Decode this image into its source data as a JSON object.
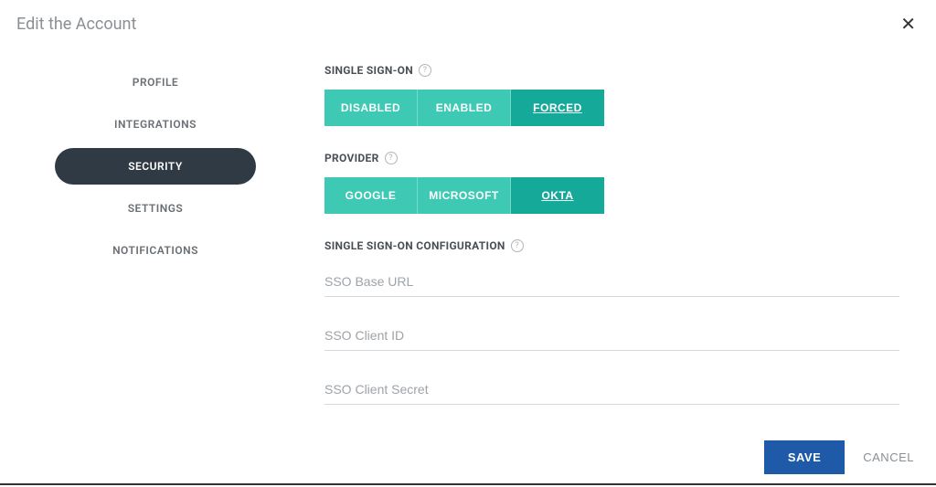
{
  "header": {
    "title": "Edit the Account"
  },
  "sidebar": {
    "items": [
      {
        "label": "PROFILE",
        "active": false
      },
      {
        "label": "INTEGRATIONS",
        "active": false
      },
      {
        "label": "SECURITY",
        "active": true
      },
      {
        "label": "SETTINGS",
        "active": false
      },
      {
        "label": "NOTIFICATIONS",
        "active": false
      }
    ]
  },
  "sections": {
    "sso": {
      "label": "SINGLE SIGN-ON",
      "options": [
        "DISABLED",
        "ENABLED",
        "FORCED"
      ],
      "selected": "FORCED"
    },
    "provider": {
      "label": "PROVIDER",
      "options": [
        "GOOGLE",
        "MICROSOFT",
        "OKTA"
      ],
      "selected": "OKTA"
    },
    "config": {
      "label": "SINGLE SIGN-ON CONFIGURATION",
      "fields": [
        {
          "placeholder": "SSO Base URL",
          "value": ""
        },
        {
          "placeholder": "SSO Client ID",
          "value": ""
        },
        {
          "placeholder": "SSO Client Secret",
          "value": ""
        }
      ]
    }
  },
  "footer": {
    "save": "SAVE",
    "cancel": "CANCEL"
  }
}
